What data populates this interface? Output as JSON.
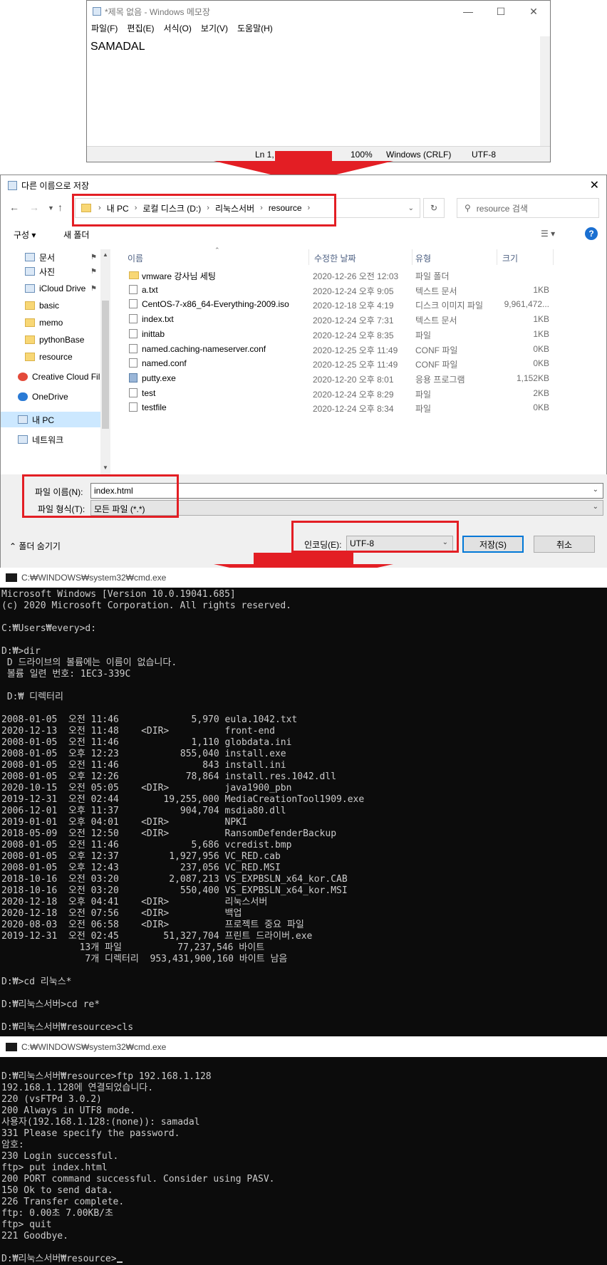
{
  "notepad": {
    "title": "*제목 없음 - Windows 메모장",
    "menu": [
      "파일(F)",
      "편집(E)",
      "서식(O)",
      "보기(V)",
      "도움말(H)"
    ],
    "content": "SAMADAL",
    "status": {
      "pos": "Ln 1, Col 8",
      "zoom": "100%",
      "eol": "Windows (CRLF)",
      "enc": "UTF-8"
    }
  },
  "dialog": {
    "title": "다른 이름으로 저장",
    "breadcrumb": [
      "내 PC",
      "로컬 디스크 (D:)",
      "리눅스서버",
      "resource"
    ],
    "search_placeholder": "resource 검색",
    "toolbar": {
      "organize": "구성 ▾",
      "new_folder": "새 폴더"
    },
    "sidebar": [
      {
        "label": "문서",
        "icon": "documents-icon",
        "pin": true
      },
      {
        "label": "사진",
        "icon": "pictures-icon",
        "pin": true
      },
      {
        "label": "iCloud Drive",
        "icon": "cloud-icon",
        "pin": true
      },
      {
        "label": "basic",
        "icon": "folder-icon",
        "pin": false
      },
      {
        "label": "memo",
        "icon": "folder-icon",
        "pin": false
      },
      {
        "label": "pythonBase",
        "icon": "folder-icon",
        "pin": false
      },
      {
        "label": "resource",
        "icon": "folder-icon",
        "pin": false
      },
      {
        "label": "Creative Cloud Fil",
        "icon": "creative-cloud-icon",
        "pin": false
      },
      {
        "label": "OneDrive",
        "icon": "onedrive-icon",
        "pin": false
      },
      {
        "label": "내 PC",
        "icon": "pc-icon",
        "pin": false
      },
      {
        "label": "네트워크",
        "icon": "network-icon",
        "pin": false
      }
    ],
    "columns": [
      "이름",
      "수정한 날짜",
      "유형",
      "크기"
    ],
    "files": [
      {
        "name": "vmware 강사님 세팅",
        "date": "2020-12-26 오전 12:03",
        "type": "파일 폴더",
        "size": "",
        "icon": "folder-icon"
      },
      {
        "name": "a.txt",
        "date": "2020-12-24 오후 9:05",
        "type": "텍스트 문서",
        "size": "1KB",
        "icon": "text-file-icon"
      },
      {
        "name": "CentOS-7-x86_64-Everything-2009.iso",
        "date": "2020-12-18 오후 4:19",
        "type": "디스크 이미지 파일",
        "size": "9,961,472...",
        "icon": "disc-image-icon"
      },
      {
        "name": "index.txt",
        "date": "2020-12-24 오후 7:31",
        "type": "텍스트 문서",
        "size": "1KB",
        "icon": "text-file-icon"
      },
      {
        "name": "inittab",
        "date": "2020-12-24 오후 8:35",
        "type": "파일",
        "size": "1KB",
        "icon": "file-icon"
      },
      {
        "name": "named.caching-nameserver.conf",
        "date": "2020-12-25 오후 11:49",
        "type": "CONF 파일",
        "size": "0KB",
        "icon": "file-icon"
      },
      {
        "name": "named.conf",
        "date": "2020-12-25 오후 11:49",
        "type": "CONF 파일",
        "size": "0KB",
        "icon": "file-icon"
      },
      {
        "name": "putty.exe",
        "date": "2020-12-20 오후 8:01",
        "type": "응용 프로그램",
        "size": "1,152KB",
        "icon": "putty-icon"
      },
      {
        "name": "test",
        "date": "2020-12-24 오후 8:29",
        "type": "파일",
        "size": "2KB",
        "icon": "file-icon"
      },
      {
        "name": "testfile",
        "date": "2020-12-24 오후 8:34",
        "type": "파일",
        "size": "0KB",
        "icon": "file-icon"
      }
    ],
    "filename_label": "파일 이름(N):",
    "filename_value": "index.html",
    "filetype_label": "파일 형식(T):",
    "filetype_value": "모든 파일 (*.*)",
    "hide_folders": "폴더 숨기기",
    "encoding_label": "인코딩(E):",
    "encoding_value": "UTF-8",
    "save_button": "저장(S)",
    "cancel_button": "취소"
  },
  "cmd1": {
    "title": "C:₩WINDOWS₩system32₩cmd.exe",
    "lines": [
      "Microsoft Windows [Version 10.0.19041.685]",
      "(c) 2020 Microsoft Corporation. All rights reserved.",
      "",
      "C:₩Users₩every>d:",
      "",
      "D:₩>dir",
      " D 드라이브의 볼륨에는 이름이 없습니다.",
      " 볼륨 일련 번호: 1EC3-339C",
      "",
      " D:₩ 디렉터리",
      "",
      "2008-01-05  오전 11:46             5,970 eula.1042.txt",
      "2020-12-13  오전 11:48    <DIR>          front-end",
      "2008-01-05  오전 11:46             1,110 globdata.ini",
      "2008-01-05  오후 12:23           855,040 install.exe",
      "2008-01-05  오전 11:46               843 install.ini",
      "2008-01-05  오후 12:26            78,864 install.res.1042.dll",
      "2020-10-15  오전 05:05    <DIR>          java1900_pbn",
      "2019-12-31  오전 02:44        19,255,000 MediaCreationTool1909.exe",
      "2006-12-01  오후 11:37           904,704 msdia80.dll",
      "2019-01-01  오후 04:01    <DIR>          NPKI",
      "2018-05-09  오전 12:50    <DIR>          RansomDefenderBackup",
      "2008-01-05  오전 11:46             5,686 vcredist.bmp",
      "2008-01-05  오후 12:37         1,927,956 VC_RED.cab",
      "2008-01-05  오후 12:43           237,056 VC_RED.MSI",
      "2018-10-16  오전 03:20         2,087,213 VS_EXPBSLN_x64_kor.CAB",
      "2018-10-16  오전 03:20           550,400 VS_EXPBSLN_x64_kor.MSI",
      "2020-12-18  오후 04:41    <DIR>          리눅스서버",
      "2020-12-18  오전 07:56    <DIR>          백업",
      "2020-08-03  오전 06:58    <DIR>          프로젝트 중요 파일",
      "2019-12-31  오전 02:45        51,327,704 프린트 드라이버.exe",
      "              13개 파일          77,237,546 바이트",
      "               7개 디렉터리  953,431,900,160 바이트 남음",
      "",
      "D:₩>cd 리눅스*",
      "",
      "D:₩리눅스서버>cd re*",
      "",
      "D:₩리눅스서버₩resource>cls"
    ]
  },
  "cmd2": {
    "title": "C:₩WINDOWS₩system32₩cmd.exe",
    "lines": [
      "D:₩리눅스서버₩resource>ftp 192.168.1.128",
      "192.168.1.128에 연결되었습니다.",
      "220 (vsFTPd 3.0.2)",
      "200 Always in UTF8 mode.",
      "사용자(192.168.1.128:(none)): samadal",
      "331 Please specify the password.",
      "암호:",
      "230 Login successful.",
      "ftp> put index.html",
      "200 PORT command successful. Consider using PASV.",
      "150 Ok to send data.",
      "226 Transfer complete.",
      "ftp: 0.00초 7.00KB/초",
      "ftp> quit",
      "221 Goodbye.",
      "",
      "D:₩리눅스서버₩resource>"
    ]
  },
  "colors": {
    "highlight": "#e31e24",
    "console_bg": "#0c0c0c",
    "console_fg": "#cccccc"
  }
}
